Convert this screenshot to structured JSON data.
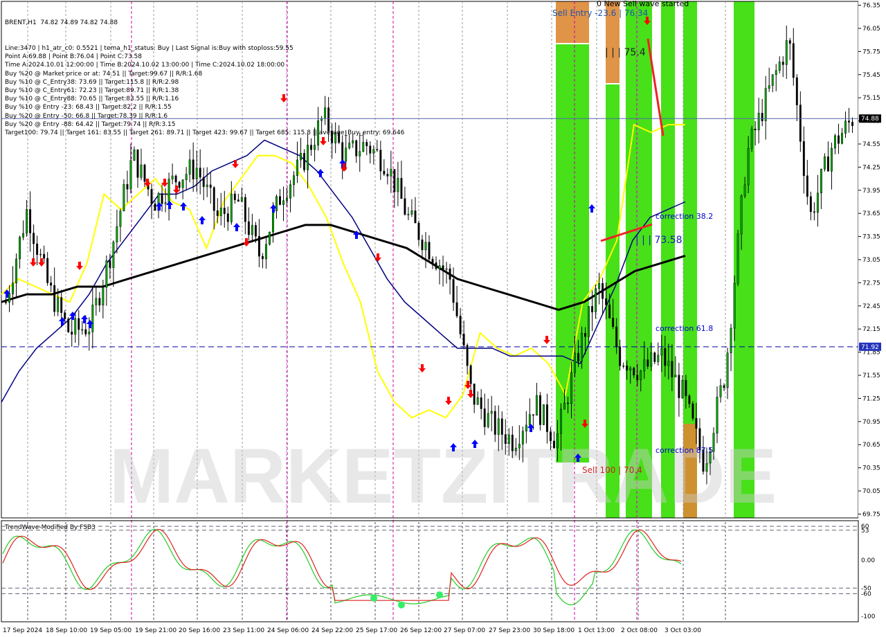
{
  "header": {
    "symbol_line": "BRENT,H1  74.82 74.89 74.82 74.88",
    "lines": [
      "Line:3470 | h1_atr_c0: 0.5521 | tema_h1_status: Buy | Last Signal is:Buy with stoploss:59.55",
      "Point A:69.88 | Point B:76.04 | Point C:73.58",
      "Time A:2024.10.01 12:00:00 | Time B:2024.10.02 13:00:00 | Time C:2024.10.02 18:00:00",
      "Buy %20 @ Market price or at: 74.51 || Target:99.67 || R/R:1.68",
      "Buy %10 @ C_Entry38: 73.69 || Target:115.8 || R/R:2.98",
      "Buy %10 @ C_Entry61: 72.23 || Target:89.71 || R/R:1.38",
      "Buy %10 @ C_Entry88: 70.65 || Target:83.55 || R/R:1.16",
      "Buy %10 @ Entry -23: 68.43 || Target:82.2 || R/R:1.55",
      "Buy %20 @ Entry -50: 66.8 || Target:78.39 || R/R:1.6",
      "Buy %20 @ Entry -88: 64.42 || Target:79.74 || R/R:3.15",
      "Target100: 79.74 || Target 161: 83.55 || Target 261: 89.71 || Target 423: 99.67 || Target 685: 115.8 || average_Buy_entry: 69.646"
    ]
  },
  "annotations": {
    "new_sell_wave": "0 New Sell wave started",
    "sell_entry": "Sell Entry -23.6 | 76.34",
    "point_b_label": "| | | 75.4",
    "point_c_label": "| | | 73.58",
    "correction_382": "correction 38.2",
    "correction_618": "correction 61.8",
    "correction_875": "correction 87.5",
    "sell_100": "Sell 100 | 70.4",
    "watermark": "MARKETZITRADE"
  },
  "price_axis": {
    "ticks": [
      "76.35",
      "76.05",
      "75.75",
      "75.45",
      "75.15",
      "74.85",
      "74.55",
      "74.25",
      "73.95",
      "73.65",
      "73.35",
      "73.05",
      "72.75",
      "72.45",
      "72.15",
      "71.85",
      "71.55",
      "71.25",
      "70.95",
      "70.65",
      "70.35",
      "70.05",
      "69.75"
    ],
    "current_price": "74.88",
    "level_price": "71.92"
  },
  "time_axis": {
    "labels": [
      "17 Sep 2024",
      "18 Sep 10:00",
      "19 Sep 05:00",
      "19 Sep 21:00",
      "20 Sep 16:00",
      "23 Sep 11:00",
      "24 Sep 06:00",
      "24 Sep 22:00",
      "25 Sep 17:00",
      "26 Sep 12:00",
      "27 Sep 07:00",
      "27 Sep 23:00",
      "30 Sep 18:00",
      "1 Oct 13:00",
      "2 Oct 08:00",
      "3 Oct 03:00"
    ]
  },
  "indicator": {
    "title": "TrendWave-Modified By FSB3",
    "ticks": [
      "60",
      "53",
      "0.00",
      "-50",
      "-60",
      "-100"
    ]
  },
  "colors": {
    "bull_candle": "#00aa00",
    "bear_candle": "#000000",
    "ema_fast": "#ffff00",
    "ema_mid": "#000080",
    "ema_slow": "#000000",
    "green_zone": "#33dd00",
    "orange_zone": "#dd8833",
    "buy_arrow": "#0000ff",
    "sell_arrow": "#ff0000"
  },
  "chart_data": {
    "type": "candlestick",
    "symbol": "BRENT",
    "timeframe": "H1",
    "x": [
      "17 Sep 2024",
      "18 Sep 10:00",
      "19 Sep 05:00",
      "19 Sep 21:00",
      "20 Sep 16:00",
      "23 Sep 11:00",
      "24 Sep 06:00",
      "24 Sep 22:00",
      "25 Sep 17:00",
      "26 Sep 12:00",
      "27 Sep 07:00",
      "27 Sep 23:00",
      "30 Sep 18:00",
      "1 Oct 13:00",
      "2 Oct 08:00",
      "3 Oct 03:00"
    ],
    "ylim": [
      69.7,
      76.4
    ],
    "close_path": [
      72.5,
      73.7,
      72.7,
      72.1,
      72.2,
      73.2,
      74.4,
      73.8,
      74.1,
      74.25,
      73.6,
      73.8,
      73.1,
      73.9,
      74.3,
      74.9,
      74.4,
      74.55,
      74.3,
      73.6,
      73.2,
      72.8,
      71.3,
      70.9,
      70.7,
      71.2,
      70.7,
      71.8,
      72.7,
      71.8,
      71.6,
      71.8,
      71.3,
      70.4,
      71.6,
      74.4,
      75.2,
      75.9,
      73.6,
      74.5,
      74.88
    ],
    "series": [
      {
        "name": "ema_fast",
        "values": [
          72.6,
          72.8,
          72.7,
          72.6,
          72.5,
          73.0,
          73.9,
          73.7,
          73.9,
          74.1,
          73.8,
          73.7,
          73.2,
          73.8,
          74.1,
          74.4,
          74.4,
          74.3,
          74.0,
          73.6,
          73.0,
          72.5,
          71.6,
          71.2,
          71.0,
          71.1,
          71.0,
          71.3,
          72.1,
          71.9,
          71.8,
          71.9,
          71.7,
          71.3,
          72.5,
          72.8,
          73.3,
          74.8,
          74.7,
          74.8,
          74.8
        ]
      },
      {
        "name": "ema_mid",
        "values": [
          71.2,
          71.6,
          71.9,
          72.1,
          72.3,
          72.6,
          73.0,
          73.3,
          73.6,
          73.9,
          73.9,
          74.0,
          74.2,
          74.3,
          74.4,
          74.6,
          74.5,
          74.4,
          74.2,
          73.9,
          73.6,
          73.2,
          72.8,
          72.5,
          72.3,
          72.1,
          71.9,
          71.9,
          71.9,
          71.8,
          71.8,
          71.8,
          71.8,
          71.7,
          72.2,
          72.7,
          73.3,
          73.6,
          73.7,
          73.8
        ]
      },
      {
        "name": "ema_slow",
        "values": [
          72.5,
          72.6,
          72.6,
          72.7,
          72.7,
          72.8,
          72.9,
          73.0,
          73.1,
          73.2,
          73.3,
          73.4,
          73.5,
          73.5,
          73.4,
          73.3,
          73.2,
          73.0,
          72.8,
          72.7,
          72.6,
          72.5,
          72.4,
          72.5,
          72.7,
          72.9,
          73.0,
          73.1
        ]
      }
    ],
    "levels": [
      {
        "value": 74.88,
        "style": "solid"
      },
      {
        "value": 71.92,
        "style": "dashed"
      }
    ],
    "indicator_ylim": [
      -110,
      70
    ]
  }
}
